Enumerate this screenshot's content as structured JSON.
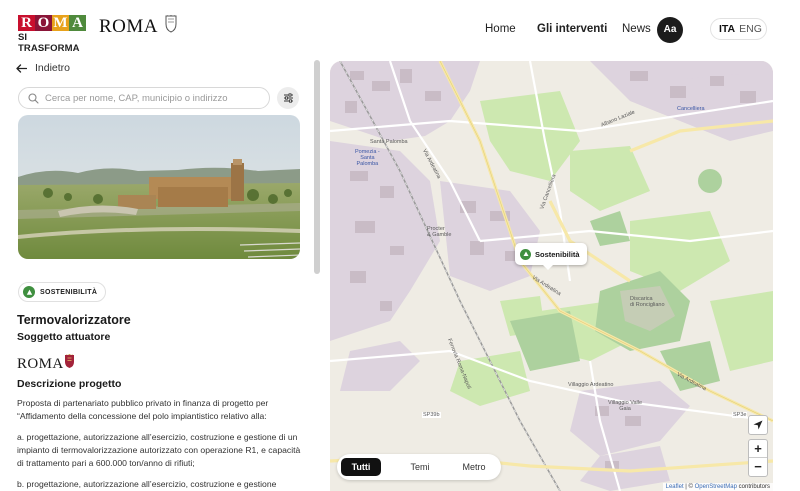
{
  "header": {
    "logo_letters": [
      "R",
      "O",
      "M",
      "A"
    ],
    "logo_colors": [
      "#c8102e",
      "#8a1538",
      "#e8a21b",
      "#4f8a3c"
    ],
    "logo_sub": "SI TRASFORMA",
    "roma_wordmark": "ROMA",
    "nav": {
      "home": "Home",
      "interventi": "Gli interventi",
      "news": "News"
    },
    "font_size_button": "Aa",
    "lang": {
      "ita": "ITA",
      "eng": "ENG"
    }
  },
  "sidebar": {
    "back_label": "Indietro",
    "search_placeholder": "Cerca per nome, CAP, municipio o indirizzo",
    "badge": "SOSTENIBILITÀ",
    "title": "Termovalorizzatore",
    "subtitle": "Soggetto attuatore",
    "actor_wordmark": "ROMA",
    "description_heading": "Descrizione progetto",
    "description": [
      "Proposta di partenariato pubblico privato in finanza di progetto per “Affidamento della concessione del polo impiantistico relativo alla:",
      "a. progettazione, autorizzazione all’esercizio, costruzione e gestione di un impianto di termovalorizzazione autorizzato con operazione R1, e capacità di trattamento pari a 600.000 ton/anno di rifiuti;",
      "b. progettazione, autorizzazione all’esercizio, costruzione e gestione"
    ]
  },
  "map": {
    "popup_label": "Sostenibilità",
    "tabs": [
      "Tutti",
      "Temi",
      "Metro"
    ],
    "active_tab": "Tutti",
    "zoom_in": "+",
    "zoom_out": "−",
    "attribution": {
      "leaflet": "Leaflet",
      "sep": " | © ",
      "osm": "OpenStreetMap",
      "rest": " contributors"
    },
    "labels": {
      "santa_palomba": "Santa Palomba",
      "pomezia": "Pomezia -\nSanta\nPalomba",
      "procter": "Procter\n& Gamble",
      "albano": "Albano Laziale",
      "cancelliera": "Cancelliera",
      "via_ardeatina": "Via Ardeatina",
      "via_cancelliera": "Via Cancelliera",
      "villaggio_ardeatino": "Villaggio Ardeatino",
      "villaggio_gaia": "Villaggio Valle\nGaia",
      "sp39b": "SP39b",
      "sp3e": "SP3e",
      "discarica": "Discarica\ndi Roncigliano",
      "ferrovia": "Ferrovia Roma-Napoli"
    },
    "colors": {
      "urban": "#ddd3de",
      "green": "#cde8b0",
      "forest": "#add19e",
      "road": "#f7e8a8",
      "base": "#efece4"
    }
  }
}
